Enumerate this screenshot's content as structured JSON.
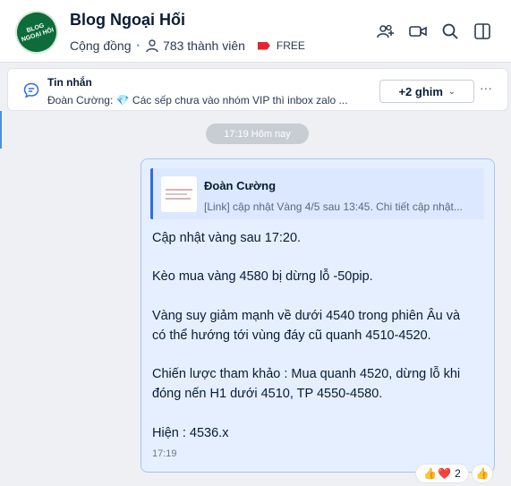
{
  "header": {
    "group_name": "Blog Ngoại Hối",
    "logo_text_line1": "BLOG",
    "logo_text_line2": "NGOẠI HỐI",
    "community_label": "Cộng đồng",
    "members": "783 thành viên",
    "plan": "FREE",
    "icons": [
      "add-member-icon",
      "video-call-icon",
      "search-icon",
      "sidebar-toggle-icon"
    ],
    "colors": {
      "logo_bg": "#0e6b3a",
      "tag": "#e6242a"
    }
  },
  "pinned": {
    "title": "Tin nhắn",
    "sender": "Đoàn Cường:",
    "gem": "💎",
    "text": "Các sếp chưa vào nhóm VIP thì inbox zalo ...",
    "pin_count_label": "+2 ghim",
    "more_label": "···"
  },
  "timeline": {
    "separator": "17:19 Hôm nay"
  },
  "message": {
    "quote": {
      "author": "Đoàn Cường",
      "text": "[Link] cập nhật Vàng 4/5 sau 13:45. Chi tiết cập nhật..."
    },
    "lines": [
      "Cập nhật vàng sau 17:20.",
      "Kèo mua vàng 4580 bị dừng lỗ -50pip.",
      "Vàng suy giảm mạnh về dưới 4540 trong phiên Âu và",
      "có thể hướng tới vùng đáy cũ quanh 4510-4520.",
      "Chiến lược tham khảo : Mua quanh 4520, dừng lỗ khi",
      "đóng nến H1 dưới 4510, TP 4550-4580.",
      "Hiện : 4536.x"
    ],
    "time": "17:19",
    "colors": {
      "bubble_bg": "#e5efff",
      "quote_bar": "#2f6ee0"
    }
  },
  "reactions": {
    "emojis": [
      "👍",
      "❤️"
    ],
    "count": "2",
    "quick_react": "👍"
  }
}
